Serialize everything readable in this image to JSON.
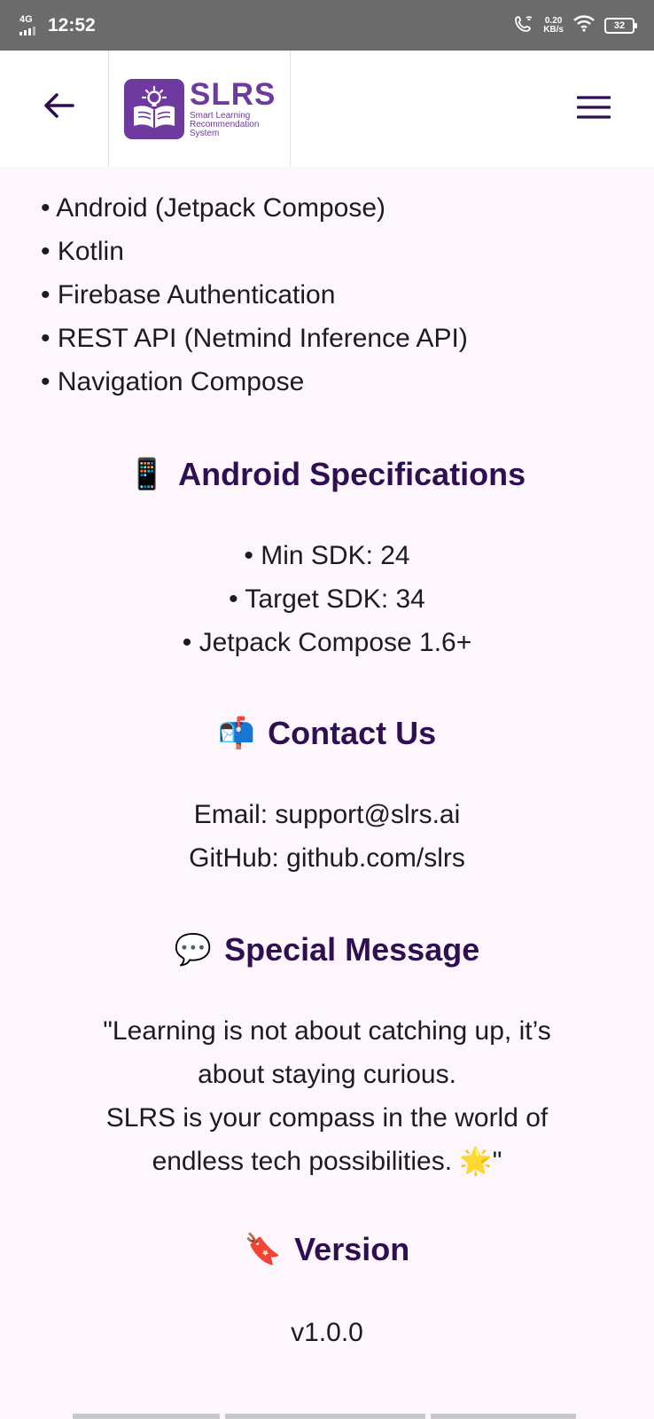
{
  "status_bar": {
    "network": "4G",
    "time": "12:52",
    "speed_value": "0.20",
    "speed_unit": "KB/s",
    "battery": "32"
  },
  "app_bar": {
    "logo_title": "SLRS",
    "logo_subtitle_1": "Smart Learning",
    "logo_subtitle_2": "Recommendation",
    "logo_subtitle_3": "System",
    "back_icon": "arrow-left-icon",
    "menu_icon": "hamburger-menu-icon"
  },
  "tech_stack": [
    "Android (Jetpack Compose)",
    "Kotlin",
    "Firebase Authentication",
    "REST API (Netmind Inference API)",
    "Navigation Compose"
  ],
  "android_specs": {
    "icon": "📱",
    "title": "Android Specifications",
    "items": [
      "Min SDK: 24",
      "Target SDK: 34",
      "Jetpack Compose 1.6+"
    ]
  },
  "contact": {
    "icon": "📬",
    "title": "Contact Us",
    "email": "Email: support@slrs.ai",
    "github": "GitHub: github.com/slrs"
  },
  "special_message": {
    "icon": "💬",
    "title": "Special Message",
    "lines": [
      "\"Learning is not about catching up, it’s",
      "about staying curious.",
      "SLRS is your compass in the world of",
      "endless tech possibilities. 🌟\""
    ]
  },
  "version": {
    "icon": "🔖",
    "title": "Version",
    "value": "v1.0.0"
  },
  "colors": {
    "brand": "#6e3aa0",
    "heading": "#2f0f52",
    "background": "#fdf7fd",
    "status_bar": "#6b6b6b"
  }
}
